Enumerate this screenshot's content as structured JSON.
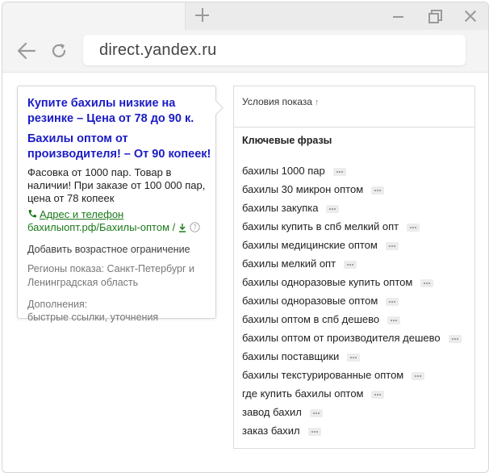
{
  "browser": {
    "url": "direct.yandex.ru"
  },
  "ad": {
    "title": "Купите бахилы низкие на резинке – Цена от 78 до 90 к.",
    "title2": "Бахилы оптом от производителя! – От 90 копеек!",
    "body": "Фасовка от 1000 пар. Товар в наличии! При заказе от 100 000 пар, цена от 78 копеек",
    "contact_link": "Адрес и телефон",
    "display_url": "бахилыопт.рф/Бахилы-оптом /",
    "age_limit_link": "Добавить возрастное ограничение",
    "regions_label": "Регионы показа: Санкт-Петербург и Ленинградская область",
    "extras_label": "Дополнения:",
    "extras_value": "быстрые ссылки, уточнения"
  },
  "conditions": {
    "header": "Условия показа",
    "sort_indicator": "↑",
    "keywords_heading": "Ключевые фразы",
    "keywords": [
      "бахилы 1000 пар",
      "бахилы 30 микрон оптом",
      "бахилы закупка",
      "бахилы купить в спб мелкий опт",
      "бахилы медицинские оптом",
      "бахилы мелкий опт",
      "бахилы одноразовые купить оптом",
      "бахилы одноразовые оптом",
      "бахилы оптом в спб дешево",
      "бахилы оптом от производителя дешево",
      "бахилы поставщики",
      "бахилы текстурированные оптом",
      "где купить бахилы оптом",
      "завод бахил",
      "заказ бахил"
    ]
  },
  "colors": {
    "ad_title": "#1b1bc7",
    "ad_link": "#1a7a1a",
    "browser_chrome": "#ebebeb"
  }
}
